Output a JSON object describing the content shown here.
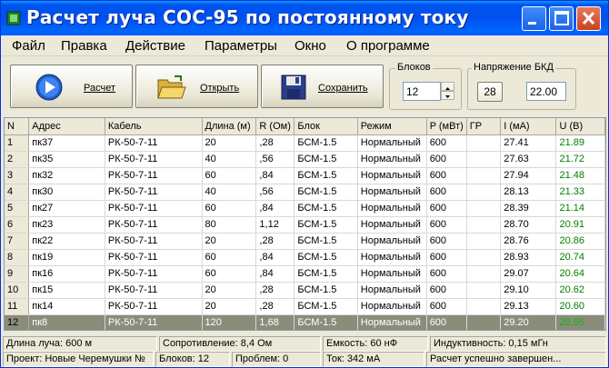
{
  "window": {
    "title": "Расчет луча СОС-95 по постоянному току"
  },
  "menu": [
    "Файл",
    "Правка",
    "Действие",
    "Параметры",
    "Окно",
    "О программе"
  ],
  "toolbar": {
    "calc_label": "Расчет",
    "open_label": "Открыть",
    "save_label": "Сохранить",
    "blocks_label": "Блоков",
    "blocks_value": "12",
    "voltage_label": "Напряжение БКД",
    "voltage_button": "28",
    "voltage_value": "22.00"
  },
  "table": {
    "columns": [
      "N",
      "Адрес",
      "Кабель",
      "Длина (м)",
      "R (Ом)",
      "Блок",
      "Режим",
      "P (мВт)",
      "ГР",
      "I (мА)",
      "U (В)"
    ],
    "rows": [
      [
        "1",
        "пк37",
        "РК-50-7-11",
        "20",
        ",28",
        "БСМ-1.5",
        "Нормальный",
        "600",
        "",
        "27.41",
        "21.89"
      ],
      [
        "2",
        "пк35",
        "РК-50-7-11",
        "40",
        ",56",
        "БСМ-1.5",
        "Нормальный",
        "600",
        "",
        "27.63",
        "21.72"
      ],
      [
        "3",
        "пк32",
        "РК-50-7-11",
        "60",
        ",84",
        "БСМ-1.5",
        "Нормальный",
        "600",
        "",
        "27.94",
        "21.48"
      ],
      [
        "4",
        "пк30",
        "РК-50-7-11",
        "40",
        ",56",
        "БСМ-1.5",
        "Нормальный",
        "600",
        "",
        "28.13",
        "21.33"
      ],
      [
        "5",
        "пк27",
        "РК-50-7-11",
        "60",
        ",84",
        "БСМ-1.5",
        "Нормальный",
        "600",
        "",
        "28.39",
        "21.14"
      ],
      [
        "6",
        "пк23",
        "РК-50-7-11",
        "80",
        "1,12",
        "БСМ-1.5",
        "Нормальный",
        "600",
        "",
        "28.70",
        "20.91"
      ],
      [
        "7",
        "пк22",
        "РК-50-7-11",
        "20",
        ",28",
        "БСМ-1.5",
        "Нормальный",
        "600",
        "",
        "28.76",
        "20.86"
      ],
      [
        "8",
        "пк19",
        "РК-50-7-11",
        "60",
        ",84",
        "БСМ-1.5",
        "Нормальный",
        "600",
        "",
        "28.93",
        "20.74"
      ],
      [
        "9",
        "пк16",
        "РК-50-7-11",
        "60",
        ",84",
        "БСМ-1.5",
        "Нормальный",
        "600",
        "",
        "29.07",
        "20.64"
      ],
      [
        "10",
        "пк15",
        "РК-50-7-11",
        "20",
        ",28",
        "БСМ-1.5",
        "Нормальный",
        "600",
        "",
        "29.10",
        "20.62"
      ],
      [
        "11",
        "пк14",
        "РК-50-7-11",
        "20",
        ",28",
        "БСМ-1.5",
        "Нормальный",
        "600",
        "",
        "29.13",
        "20.60"
      ],
      [
        "12",
        "пк8",
        "РК-50-7-11",
        "120",
        "1,68",
        "БСМ-1.5",
        "Нормальный",
        "600",
        "",
        "29.20",
        "20.55"
      ]
    ],
    "selected_row": 11
  },
  "status1": {
    "length": "Длина луча: 600 м",
    "resistance": "Сопротивление: 8,4 Ом",
    "capacity": "Емкость: 60 нФ",
    "inductance": "Индуктивность: 0,15 мГн"
  },
  "status2": {
    "project": "Проект: Новые Черемушки №",
    "blocks": "Блоков: 12",
    "problems": "Проблем: 0",
    "current": "Ток: 342 мА",
    "message": "Расчет успешно завершен..."
  },
  "colors": {
    "title_bar": "#0053ee",
    "selected_row": "#8c8c7a",
    "voltage_text": "#008000"
  }
}
